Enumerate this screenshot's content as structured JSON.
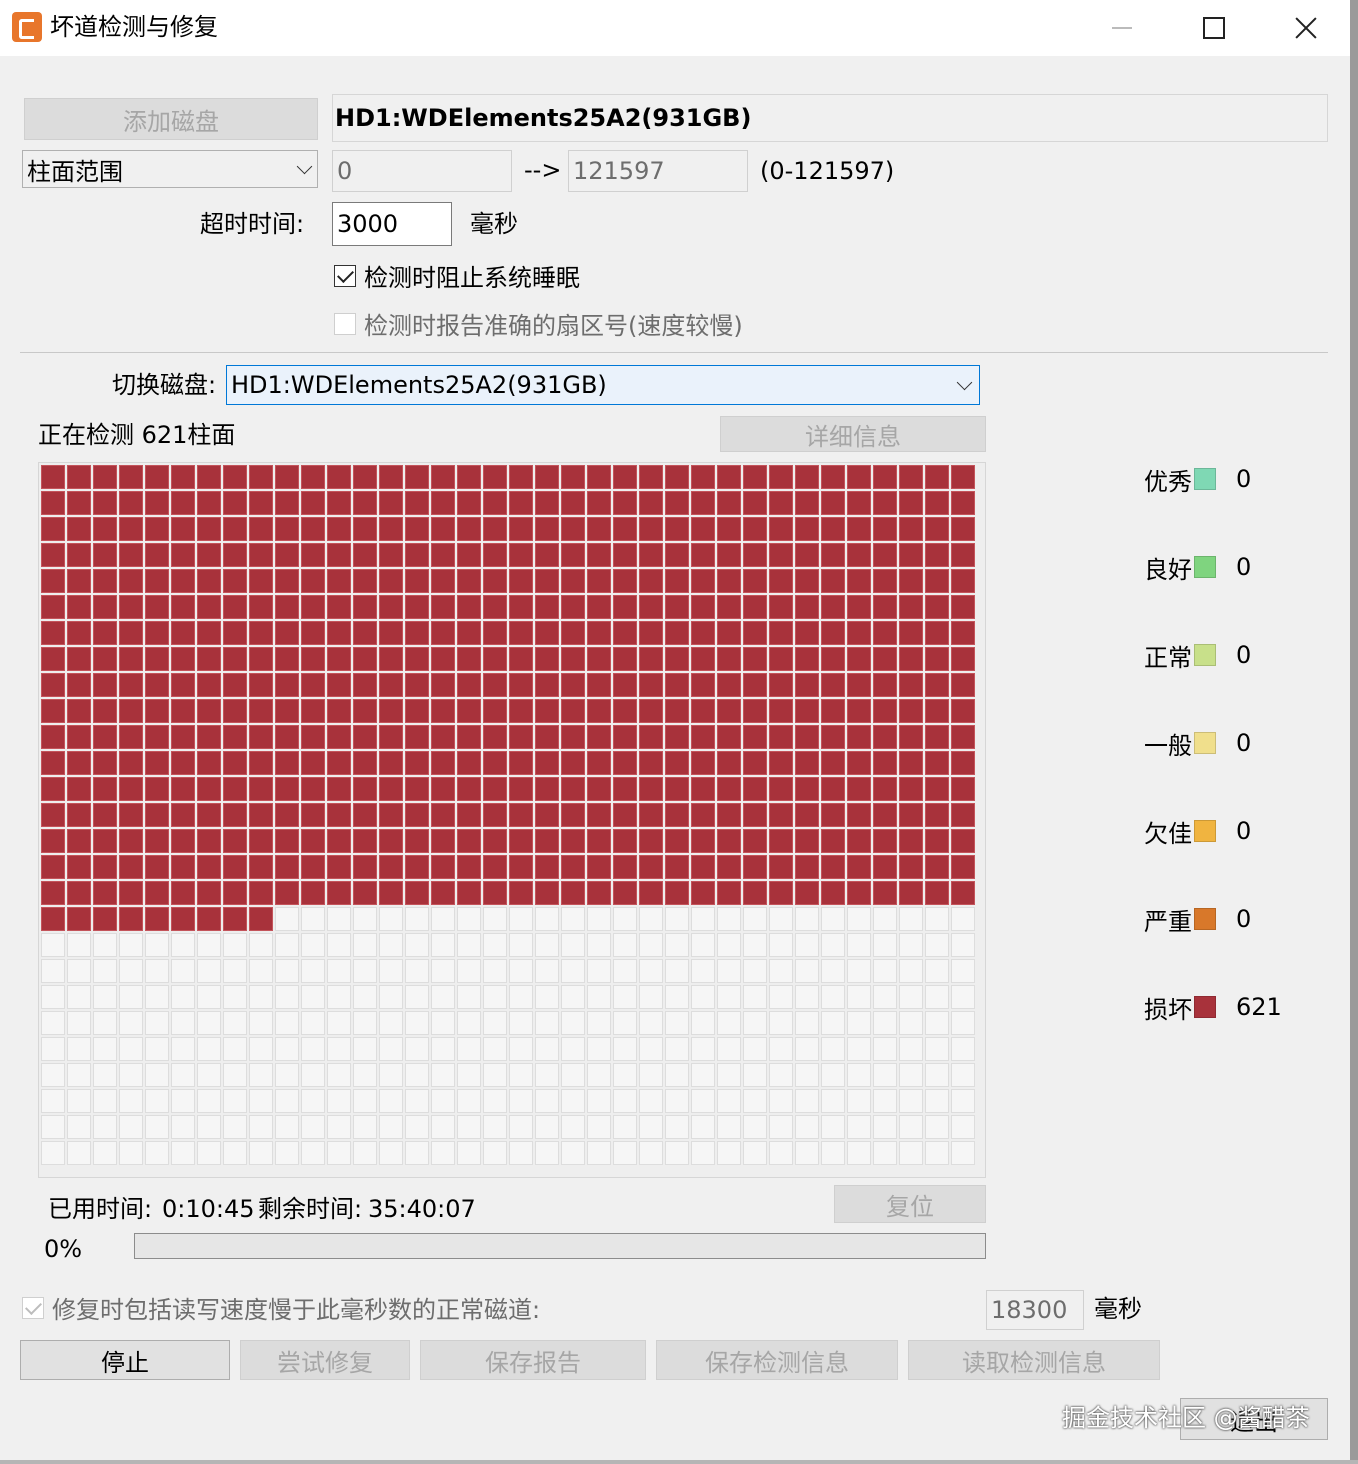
{
  "window": {
    "title": "坏道检测与修复",
    "icons": {
      "logo": "app-logo-icon",
      "minimize": "minimize-icon",
      "maximize": "maximize-icon",
      "close": "close-icon"
    }
  },
  "setup": {
    "add_disk_label": "添加磁盘",
    "disk_name": "HD1:WDElements25A2(931GB)",
    "range_mode": "柱面范围",
    "range_start": "0",
    "arrow": "-->",
    "range_end": "121597",
    "range_hint": "(0-121597)",
    "timeout_label": "超时时间:",
    "timeout_value": "3000",
    "timeout_unit": "毫秒",
    "prevent_sleep_label": "检测时阻止系统睡眠",
    "prevent_sleep_checked": true,
    "report_sector_label": "检测时报告准确的扇区号(速度较慢)",
    "report_sector_checked": false
  },
  "scan": {
    "switch_disk_label": "切换磁盘:",
    "switch_disk_value": "HD1:WDElements25A2(931GB)",
    "status_text": "正在检测 621柱面",
    "details_label": "详细信息",
    "grid": {
      "columns": 36,
      "rows": 27,
      "bad_cells": 621,
      "bad_color": "#a8323b",
      "empty_color": "#f6f6f6"
    }
  },
  "legend": [
    {
      "label": "优秀",
      "color": "#7fd8b4",
      "count": "0"
    },
    {
      "label": "良好",
      "color": "#7fd47f",
      "count": "0"
    },
    {
      "label": "正常",
      "color": "#c8e08a",
      "count": "0"
    },
    {
      "label": "一般",
      "color": "#f0df8c",
      "count": "0"
    },
    {
      "label": "欠佳",
      "color": "#f0b440",
      "count": "0"
    },
    {
      "label": "严重",
      "color": "#d8782a",
      "count": "0"
    },
    {
      "label": "损坏",
      "color": "#a8323b",
      "count": "621"
    }
  ],
  "timing": {
    "elapsed_label": "已用时间:",
    "elapsed_value": "0:10:45",
    "remaining_label": "剩余时间:",
    "remaining_value": "35:40:07",
    "reset_label": "复位",
    "progress_text": "0%",
    "progress_fraction": 0
  },
  "repair": {
    "slow_track_label": "修复时包括读写速度慢于此毫秒数的正常磁道:",
    "slow_track_checked": true,
    "slow_track_value": "18300",
    "slow_track_unit": "毫秒"
  },
  "actions": {
    "stop": "停止",
    "try_repair": "尝试修复",
    "save_report": "保存报告",
    "save_scan": "保存检测信息",
    "load_scan": "读取检测信息",
    "exit": "退出"
  },
  "watermark": "掘金技术社区 @酱醋茶"
}
